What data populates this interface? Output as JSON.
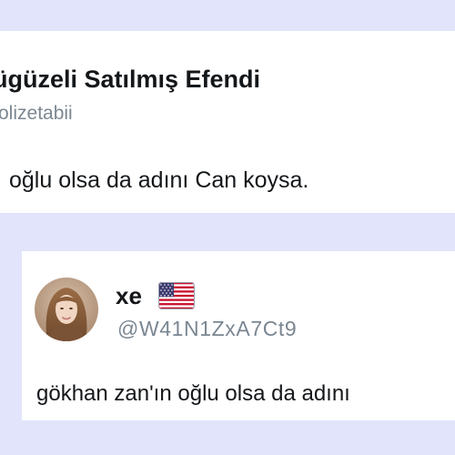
{
  "tweet": {
    "display_name": "ügüzeli Satılmış Efendi",
    "handle": "olizetabii",
    "text": "oğlu olsa da adını Can koysa."
  },
  "quoted_tweet": {
    "display_name": "xe",
    "flag_icon": "us-flag-icon",
    "handle": "@W41N1ZxA7Ct9",
    "text": "gökhan zan'ın oğlu olsa da adını"
  },
  "colors": {
    "page_background": "#e1e4fa",
    "card_background": "#ffffff",
    "text_primary": "#14171a",
    "text_secondary": "#7b8792"
  }
}
